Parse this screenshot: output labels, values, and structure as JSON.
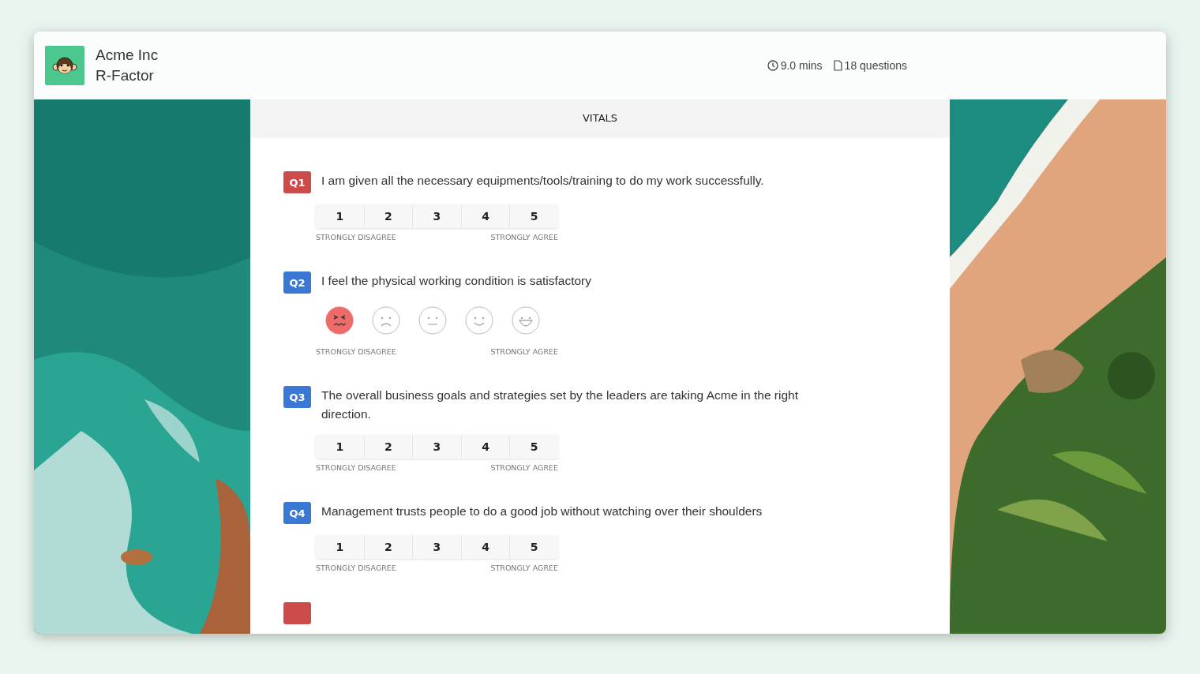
{
  "header": {
    "company": "Acme Inc",
    "survey": "R-Factor",
    "duration": "9.0 mins",
    "questions": "18 questions"
  },
  "section": {
    "title": "VITALS"
  },
  "questions": [
    {
      "kind": "scale",
      "number": "Q1",
      "color": "#cc4b4b",
      "text": "I am given all the necessary equipments/tools/training to do my work successfully.",
      "options": [
        {
          "label": "1",
          "selected": false
        },
        {
          "label": "2",
          "selected": false
        },
        {
          "label": "3",
          "selected": false
        },
        {
          "label": "4",
          "selected": false
        },
        {
          "label": "5",
          "selected": false
        }
      ],
      "low": "STRONGLY DISAGREE",
      "high": "STRONGLY AGREE"
    },
    {
      "kind": "faces",
      "number": "Q2",
      "color": "#3a78d4",
      "text": "I feel the physical working condition is satisfactory",
      "options": [
        {
          "selected": true
        },
        {
          "selected": false
        },
        {
          "selected": false
        },
        {
          "selected": false
        },
        {
          "selected": false
        }
      ],
      "low": "STRONGLY DISAGREE",
      "high": "STRONGLY AGREE"
    },
    {
      "kind": "scale",
      "number": "Q3",
      "color": "#3a78d4",
      "text": "The overall business goals and strategies set by the leaders are taking Acme in the right direction.",
      "options": [
        {
          "label": "1",
          "selected": false
        },
        {
          "label": "2",
          "selected": false
        },
        {
          "label": "3",
          "selected": false
        },
        {
          "label": "4",
          "selected": false
        },
        {
          "label": "5",
          "selected": false
        }
      ],
      "low": "STRONGLY DISAGREE",
      "high": "STRONGLY AGREE"
    },
    {
      "kind": "scale",
      "number": "Q4",
      "color": "#3a78d4",
      "text": "Management trusts people to do a good job without watching over their shoulders",
      "options": [
        {
          "label": "1",
          "selected": false
        },
        {
          "label": "2",
          "selected": false
        },
        {
          "label": "3",
          "selected": false
        },
        {
          "label": "4",
          "selected": false
        },
        {
          "label": "5",
          "selected": false
        }
      ],
      "low": "STRONGLY DISAGREE",
      "high": "STRONGLY AGREE"
    },
    {
      "kind": "cut",
      "color": "#cc4b4b"
    }
  ]
}
